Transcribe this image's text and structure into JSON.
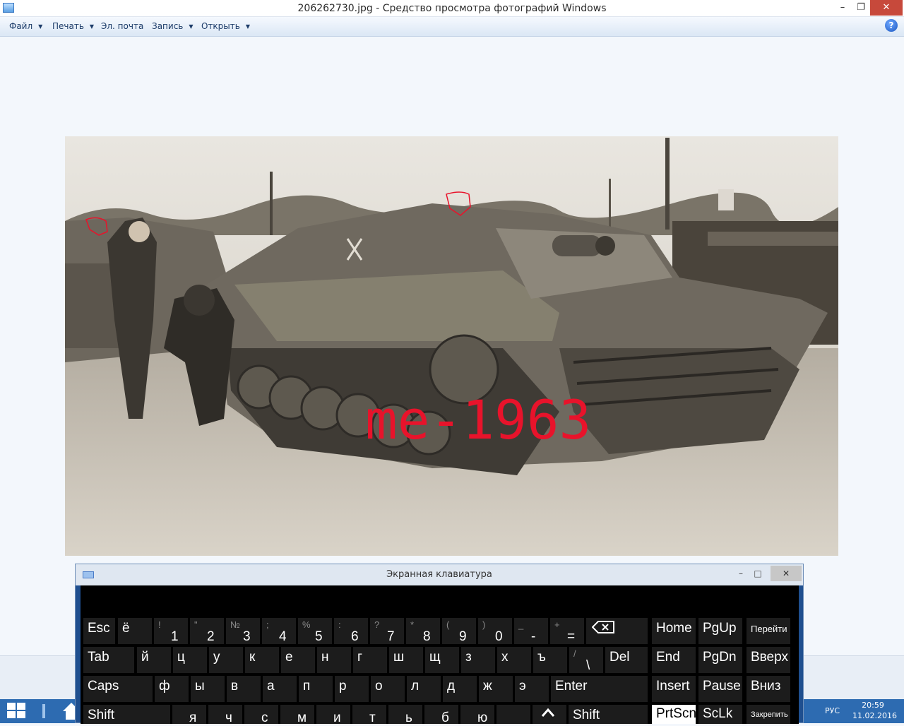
{
  "window": {
    "title": "206262730.jpg - Средство просмотра фотографий Windows",
    "min": "–",
    "max": "❐",
    "close": "✕"
  },
  "menu": {
    "file": "Файл",
    "print": "Печать",
    "email": "Эл. почта",
    "burn": "Запись",
    "open": "Открыть",
    "help": "?"
  },
  "photo": {
    "watermark": "me-1963",
    "description_icon": "photo-image"
  },
  "osk": {
    "title": "Экранная клавиатура",
    "min": "–",
    "max": "□",
    "close": "✕",
    "row1": [
      {
        "top": "",
        "main": "Esc"
      },
      {
        "top": "",
        "main": "ё"
      },
      {
        "top": "!",
        "main": "1"
      },
      {
        "top": "\"",
        "main": "2"
      },
      {
        "top": "№",
        "main": "3"
      },
      {
        "top": ";",
        "main": "4"
      },
      {
        "top": "%",
        "main": "5"
      },
      {
        "top": ":",
        "main": "6"
      },
      {
        "top": "?",
        "main": "7"
      },
      {
        "top": "*",
        "main": "8"
      },
      {
        "top": "(",
        "main": "9"
      },
      {
        "top": ")",
        "main": "0"
      },
      {
        "top": "_",
        "main": "-"
      },
      {
        "top": "+",
        "main": "="
      }
    ],
    "row2": [
      "Tab",
      "й",
      "ц",
      "у",
      "к",
      "е",
      "н",
      "г",
      "ш",
      "щ",
      "з",
      "х",
      "ъ"
    ],
    "row2_backslash": {
      "top": "/",
      "main": "\\"
    },
    "row2_del": "Del",
    "row3": [
      "Caps",
      "ф",
      "ы",
      "в",
      "а",
      "п",
      "р",
      "о",
      "л",
      "д",
      "ж",
      "э"
    ],
    "row3_enter": "Enter",
    "row4": [
      "Shift",
      "я",
      "ч",
      "с",
      "м",
      "и",
      "т",
      "ь",
      "б",
      "ю",
      ""
    ],
    "row4_shift_right": "Shift",
    "nav": {
      "home": "Home",
      "pgup": "PgUp",
      "go": "Перейти",
      "end": "End",
      "pgdn": "PgDn",
      "up": "Вверх",
      "insert": "Insert",
      "pause": "Pause",
      "down": "Вниз",
      "prtscn": "PrtScn",
      "sclk": "ScLk",
      "dock": "Закрепить"
    },
    "icons": {
      "backspace": "backspace-icon",
      "up_arrow": "up-arrow-icon"
    }
  },
  "taskbar": {
    "lang": "РУС",
    "time": "20:59",
    "date": "11.02.2016"
  },
  "colors": {
    "accent": "#2d6bb1",
    "watermark": "#e8132b",
    "close": "#c7493b"
  }
}
